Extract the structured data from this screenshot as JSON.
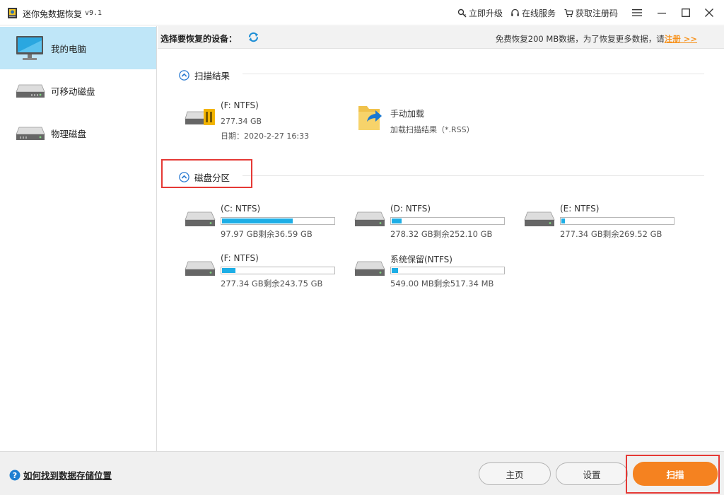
{
  "window": {
    "title": "迷你兔数据恢复",
    "version": "v9.1",
    "links": {
      "upgrade": "立即升级",
      "service": "在线服务",
      "register_code": "获取注册码"
    }
  },
  "sidebar": {
    "items": [
      {
        "label": "我的电脑",
        "icon": "monitor-icon",
        "active": true
      },
      {
        "label": "可移动磁盘",
        "icon": "removable-drive-icon",
        "active": false
      },
      {
        "label": "物理磁盘",
        "icon": "physical-disk-icon",
        "active": false
      }
    ]
  },
  "device_bar": {
    "title": "选择要恢复的设备：",
    "note": "免费恢复200 MB数据，为了恢复更多数据，请",
    "register_link": "注册 >>"
  },
  "scan_results": {
    "heading": "扫描结果",
    "items": [
      {
        "name": "(F: NTFS)",
        "size": "277.34 GB",
        "date": "日期：2020-2-27 16:33",
        "icon": "drive-with-results-icon"
      },
      {
        "name": "手动加载",
        "sub": "加载扫描结果（*.RSS）",
        "icon": "folder-load-icon"
      }
    ]
  },
  "partitions": {
    "heading": "磁盘分区",
    "items": [
      {
        "name": "(C: NTFS)",
        "usage": "97.97 GB剩余36.59 GB",
        "used_fraction": 0.63
      },
      {
        "name": "(D: NTFS)",
        "usage": "278.32 GB剩余252.10 GB",
        "used_fraction": 0.09
      },
      {
        "name": "(E: NTFS)",
        "usage": "277.34 GB剩余269.52 GB",
        "used_fraction": 0.03
      },
      {
        "name": "(F: NTFS)",
        "usage": "277.34 GB剩余243.75 GB",
        "used_fraction": 0.12
      },
      {
        "name": "系统保留(NTFS)",
        "usage": "549.00 MB剩余517.34 MB",
        "used_fraction": 0.06
      }
    ]
  },
  "bottom": {
    "help": "如何找到数据存储位置",
    "home": "主页",
    "settings": "设置",
    "scan": "扫描"
  },
  "colors": {
    "accent": "#1daee6",
    "scan_button": "#f58220",
    "register": "#f7931e",
    "highlight": "#e53935",
    "active_sidebar": "#bfe6f8"
  }
}
